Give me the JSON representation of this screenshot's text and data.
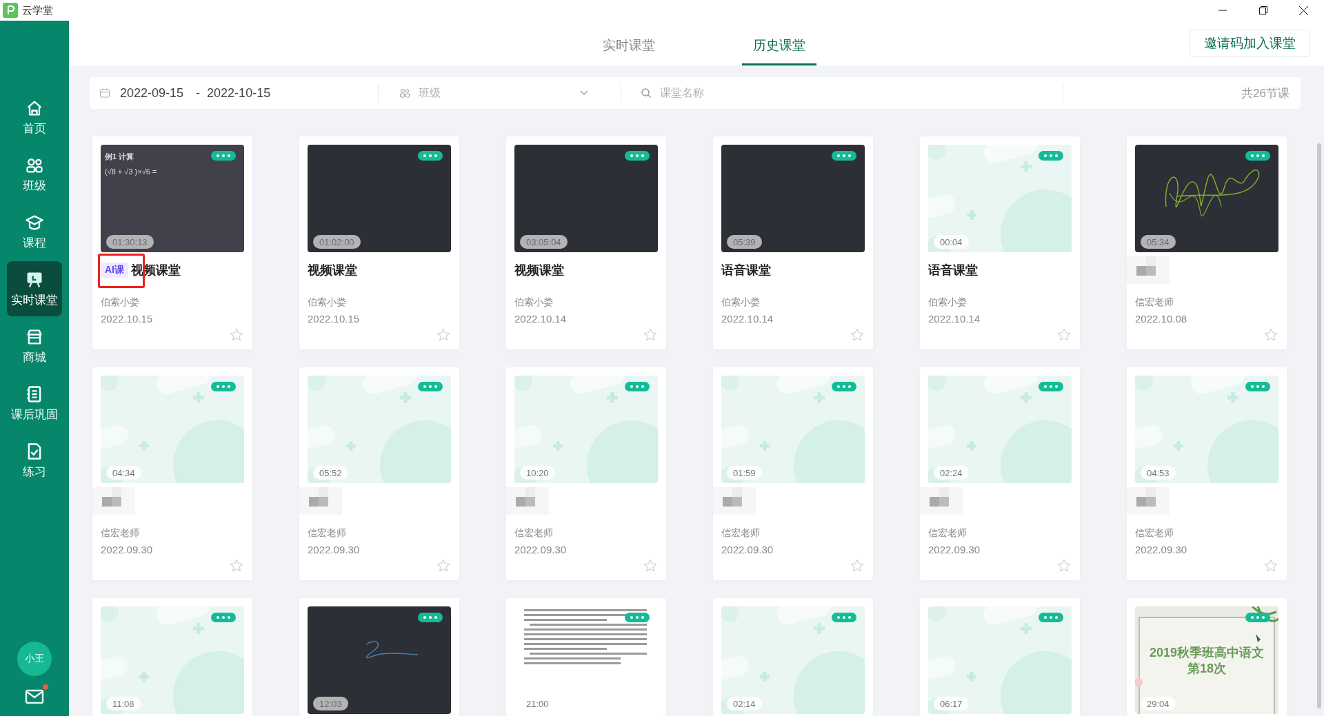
{
  "window": {
    "title": "云学堂"
  },
  "sidebar": {
    "items": [
      {
        "label": "首页",
        "selected": false
      },
      {
        "label": "班级",
        "selected": false
      },
      {
        "label": "课程",
        "selected": false
      },
      {
        "label": "实时课堂",
        "selected": true
      },
      {
        "label": "商城",
        "selected": false
      },
      {
        "label": "课后巩固",
        "selected": false
      },
      {
        "label": "练习",
        "selected": false
      }
    ],
    "avatar": "小王",
    "mail_unread": true
  },
  "tabs": [
    {
      "label": "实时课堂",
      "selected": false
    },
    {
      "label": "历史课堂",
      "selected": true
    }
  ],
  "invite_button": "邀请码加入课堂",
  "filter": {
    "date_start": "2022-09-15",
    "date_separator": "-",
    "date_end": "2022-10-15",
    "class_placeholder": "班级",
    "search_placeholder": "课堂名称",
    "total": "共26节课"
  },
  "cards": [
    {
      "thumbnail": {
        "kind": "math",
        "lines": [
          "例1  计算",
          "(√8 + √3 )×√6  ="
        ]
      },
      "duration": "01:30:13",
      "badge": "AI课",
      "highlighted": true,
      "title": "视频课堂",
      "teacher": "伯索小娄",
      "date": "2022.10.15",
      "favorite": false
    },
    {
      "thumbnail": {
        "kind": "dark"
      },
      "duration": "01:02:00",
      "title": "视频课堂",
      "teacher": "伯索小娄",
      "date": "2022.10.15",
      "favorite": false
    },
    {
      "thumbnail": {
        "kind": "dark"
      },
      "duration": "03:05:04",
      "title": "视频课堂",
      "teacher": "伯索小娄",
      "date": "2022.10.14",
      "favorite": false
    },
    {
      "thumbnail": {
        "kind": "dark"
      },
      "duration": "05:39",
      "title": "语音课堂",
      "teacher": "伯索小娄",
      "date": "2022.10.14",
      "favorite": false
    },
    {
      "thumbnail": {
        "kind": "pattern"
      },
      "duration": "00:04",
      "title": "语音课堂",
      "teacher": "伯索小娄",
      "date": "2022.10.14",
      "favorite": false
    },
    {
      "thumbnail": {
        "kind": "scribble"
      },
      "duration": "05:34",
      "teacher": "信宏老师",
      "date": "2022.10.08",
      "favorite": false
    },
    {
      "thumbnail": {
        "kind": "pattern"
      },
      "duration": "04:34",
      "teacher": "信宏老师",
      "date": "2022.09.30",
      "favorite": false
    },
    {
      "thumbnail": {
        "kind": "pattern"
      },
      "duration": "05:52",
      "teacher": "信宏老师",
      "date": "2022.09.30",
      "favorite": false
    },
    {
      "thumbnail": {
        "kind": "pattern"
      },
      "duration": "10:20",
      "teacher": "信宏老师",
      "date": "2022.09.30",
      "favorite": false
    },
    {
      "thumbnail": {
        "kind": "pattern"
      },
      "duration": "01:59",
      "teacher": "信宏老师",
      "date": "2022.09.30",
      "favorite": false
    },
    {
      "thumbnail": {
        "kind": "pattern"
      },
      "duration": "02:24",
      "teacher": "信宏老师",
      "date": "2022.09.30",
      "favorite": false
    },
    {
      "thumbnail": {
        "kind": "pattern"
      },
      "duration": "04:53",
      "teacher": "信宏老师",
      "date": "2022.09.30",
      "favorite": false
    },
    {
      "thumbnail": {
        "kind": "pattern"
      },
      "duration": "11:08"
    },
    {
      "thumbnail": {
        "kind": "stroke"
      },
      "duration": "12:03"
    },
    {
      "thumbnail": {
        "kind": "document"
      },
      "duration": "21:00"
    },
    {
      "thumbnail": {
        "kind": "pattern"
      },
      "duration": "02:14"
    },
    {
      "thumbnail": {
        "kind": "pattern"
      },
      "duration": "06:17"
    },
    {
      "thumbnail": {
        "kind": "slide",
        "lines": [
          "2019秋季班高中语文",
          "第18次"
        ]
      },
      "duration": "29:04"
    }
  ]
}
